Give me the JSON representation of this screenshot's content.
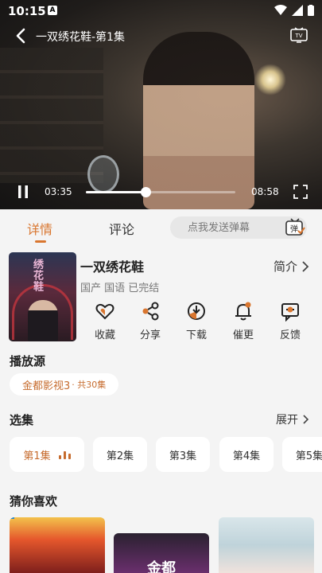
{
  "status_bar": {
    "time": "10:15",
    "notification_letter": "A"
  },
  "player": {
    "title": "一双绣花鞋-第1集",
    "current_time": "03:35",
    "total_time": "08:58",
    "progress_fraction": 0.4
  },
  "tabs": [
    {
      "label": "详情",
      "active": true
    },
    {
      "label": "评论",
      "active": false
    }
  ],
  "danmaku": {
    "placeholder": "点我发送弹幕",
    "button_glyph": "弹"
  },
  "show": {
    "poster_text": "绣花鞋",
    "title": "一双绣花鞋",
    "meta": "国产 国语 已完结",
    "intro_label": "简介"
  },
  "actions": [
    {
      "label": "收藏",
      "icon": "heart-icon"
    },
    {
      "label": "分享",
      "icon": "share-icon"
    },
    {
      "label": "下载",
      "icon": "download-icon"
    },
    {
      "label": "催更",
      "icon": "bell-icon"
    },
    {
      "label": "反馈",
      "icon": "feedback-icon"
    }
  ],
  "source": {
    "section_title": "播放源",
    "name": "金都影视3",
    "count": " · 共30集"
  },
  "episodes": {
    "section_title": "选集",
    "expand_label": "展开",
    "items": [
      "第1集",
      "第2集",
      "第3集",
      "第4集",
      "第5集"
    ],
    "active_index": 0
  },
  "recommend": {
    "section_title": "猜你喜欢",
    "item2_text": "金都"
  },
  "colors": {
    "accent": "#d9762f",
    "source_text": "#c66b2d"
  }
}
